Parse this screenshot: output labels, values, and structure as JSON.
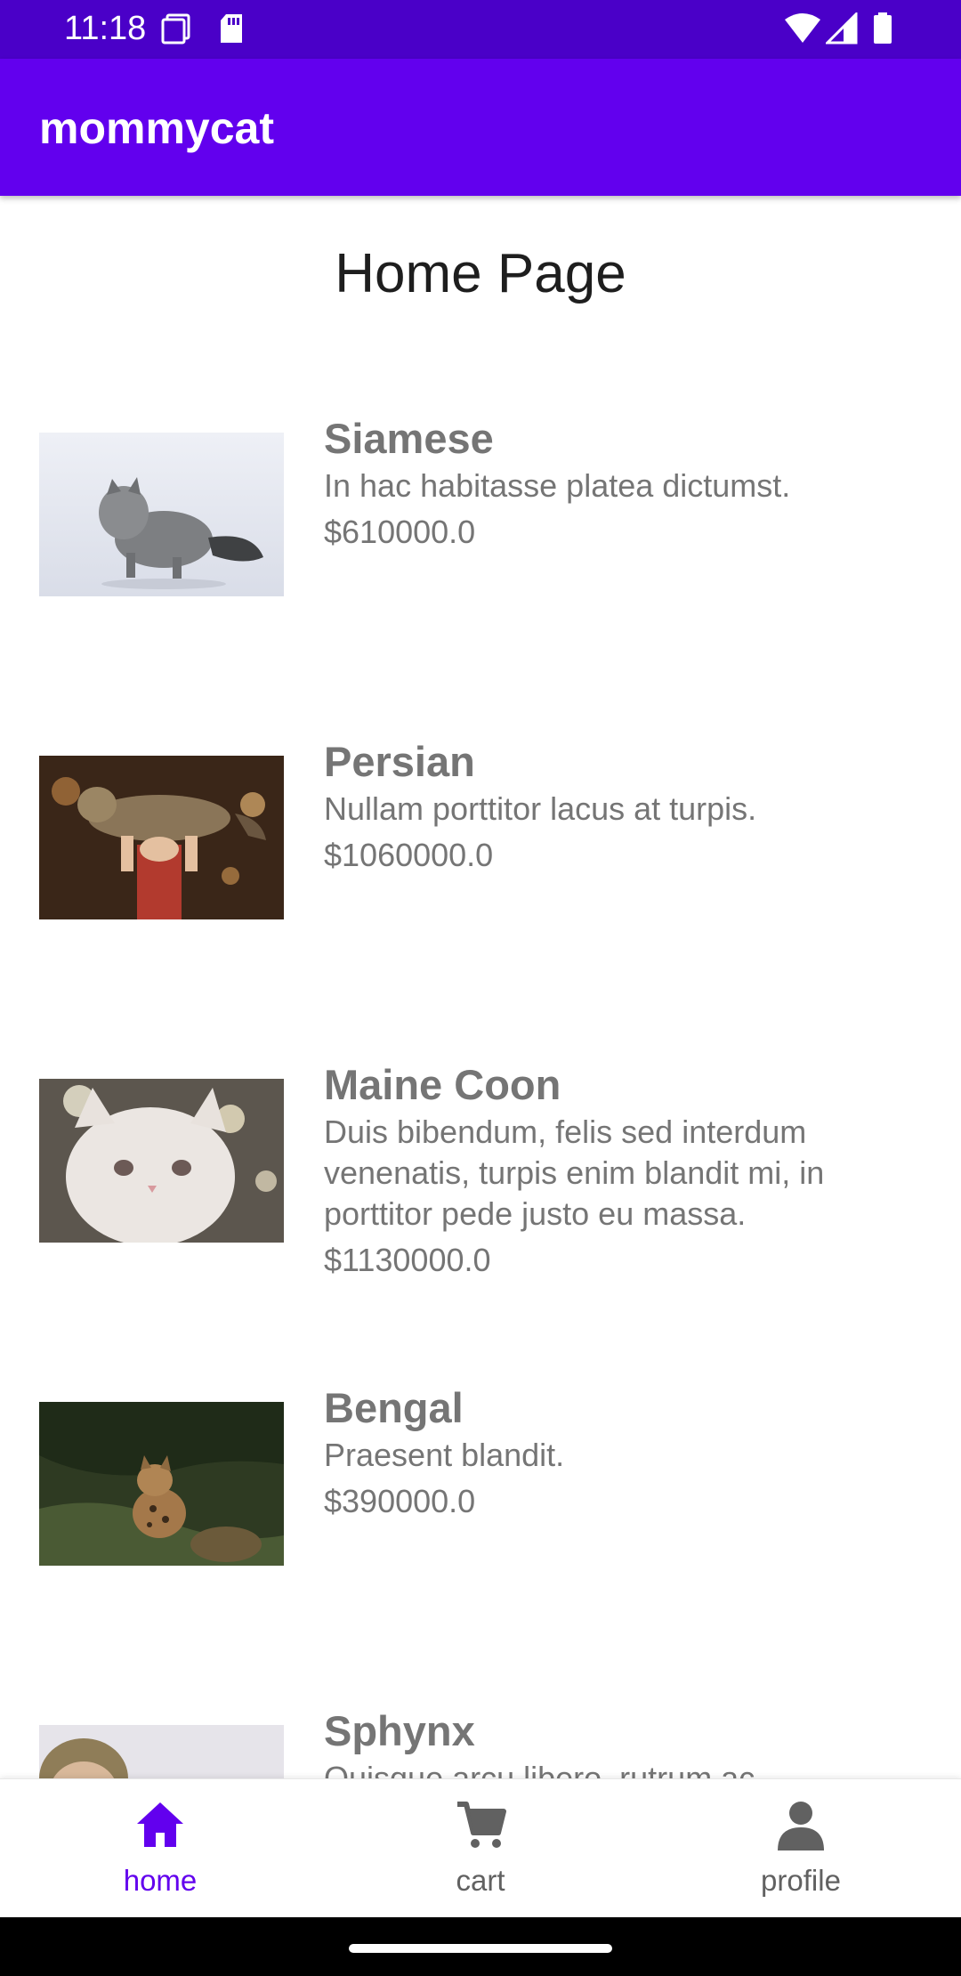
{
  "status_bar": {
    "time": "11:18",
    "icons": [
      "screenshot-icon",
      "sd-card-icon",
      "wifi-icon",
      "signal-icon",
      "battery-icon"
    ]
  },
  "app_bar": {
    "title": "mommycat"
  },
  "page": {
    "title": "Home Page"
  },
  "products": [
    {
      "name": "Siamese",
      "description": "In hac habitasse platea dictumst.",
      "price": "$610000.0",
      "image": "grey-fluffy-cat-photo"
    },
    {
      "name": "Persian",
      "description": "Nullam porttitor lacus at turpis.",
      "price": "$1060000.0",
      "image": "cat-held-up-photo"
    },
    {
      "name": "Maine Coon",
      "description": "Duis bibendum, felis sed interdum venenatis, turpis enim blandit mi, in porttitor pede justo eu massa.",
      "price": "$1130000.0",
      "image": "white-cat-photo"
    },
    {
      "name": "Bengal",
      "description": "Praesent blandit.",
      "price": "$390000.0",
      "image": "bengal-cat-in-grass-photo"
    },
    {
      "name": "Sphynx",
      "description": "Quisque arcu libero, rutrum ac,",
      "price": "",
      "image": "person-with-cat-photo"
    }
  ],
  "bottom_nav": {
    "items": [
      {
        "label": "home",
        "icon": "home-icon",
        "active": true
      },
      {
        "label": "cart",
        "icon": "cart-icon",
        "active": false
      },
      {
        "label": "profile",
        "icon": "profile-icon",
        "active": false
      }
    ]
  },
  "colors": {
    "primary": "#6200ee",
    "status_bar": "#4a00c8",
    "text_secondary": "#757575",
    "nav_inactive": "#616161"
  }
}
